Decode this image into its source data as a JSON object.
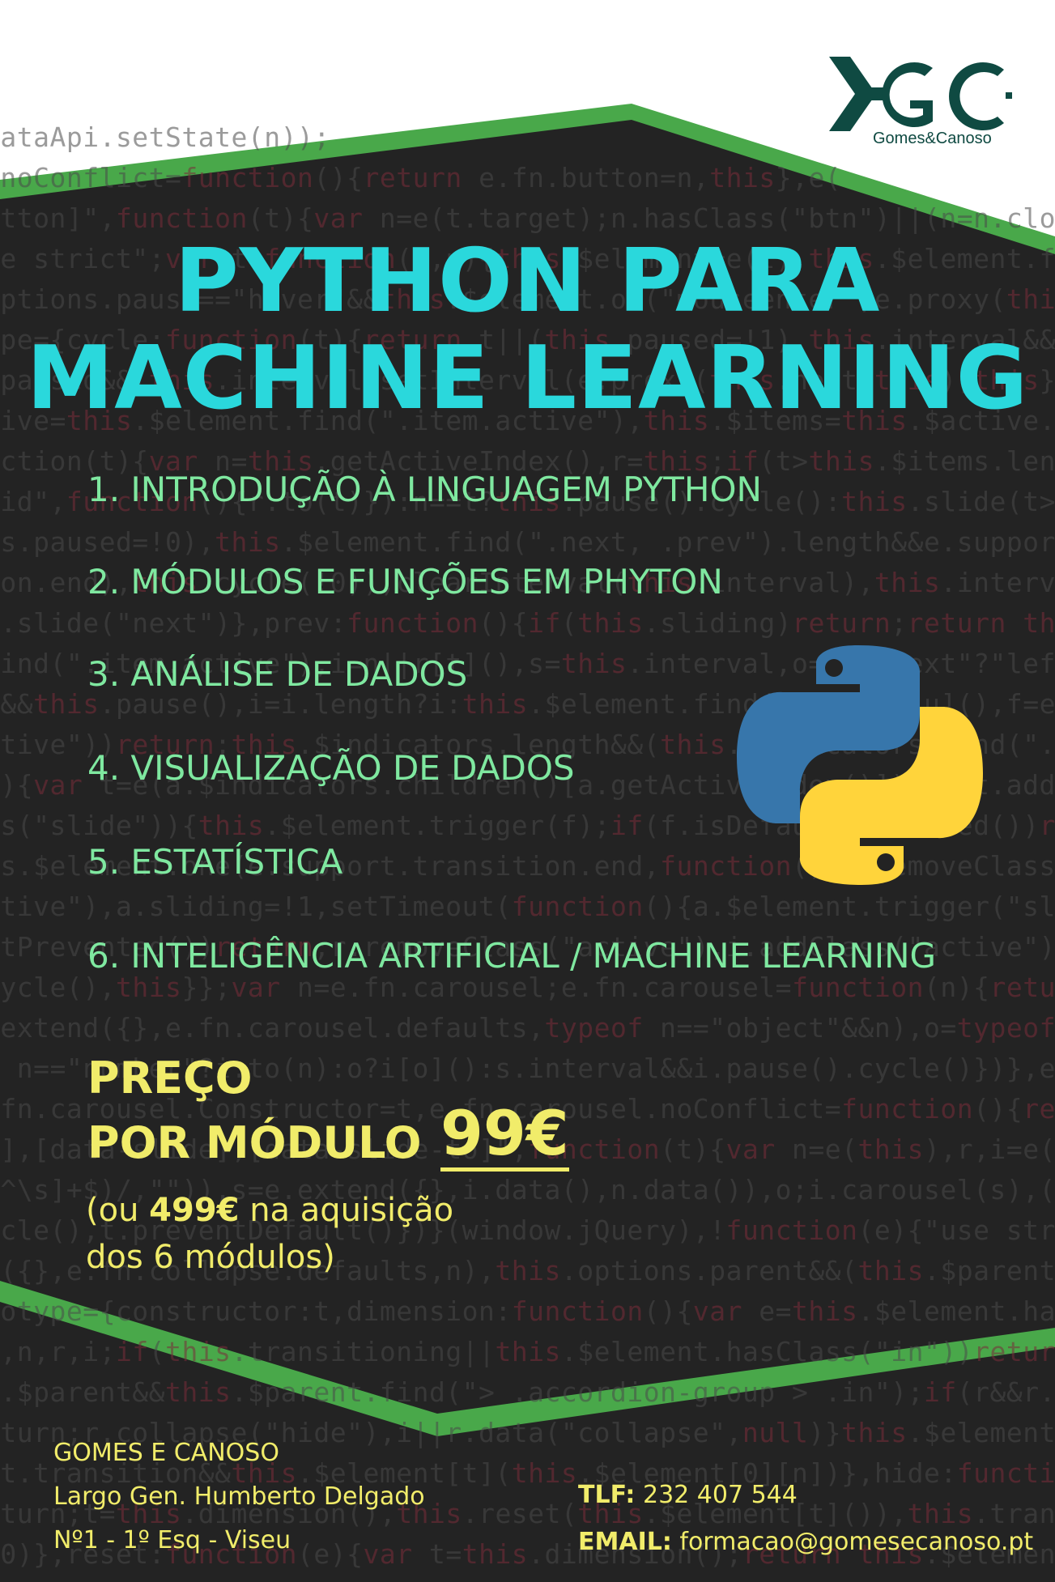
{
  "brand": {
    "logo_name": "Gomes&Canoso",
    "colors": {
      "logo": "#0f4a42",
      "green_band": "#49a84a",
      "dark_bg": "#232323",
      "title": "#2ad8dc",
      "modules": "#7fe8a0",
      "price": "#f1ec6a"
    }
  },
  "title": {
    "line1": "PYTHON PARA",
    "line2": "MACHINE LEARNING"
  },
  "modules": [
    "1. INTRODUÇÃO À LINGUAGEM PYTHON",
    "2. MÓDULOS E FUNÇÕES EM PHYTON",
    "3. ANÁLISE DE DADOS",
    "4. VISUALIZAÇÃO DE DADOS",
    "5. ESTATÍSTICA",
    "6. INTELIGÊNCIA ARTIFICIAL / MACHINE LEARNING"
  ],
  "price": {
    "label_line1": "PREÇO",
    "label_line2": "POR MÓDULO",
    "value": "99€",
    "note_prefix": "(ou ",
    "note_bold": "499€",
    "note_suffix": " na aquisição",
    "note_line2": "dos 6 módulos)"
  },
  "address": {
    "company": "GOMES E CANOSO",
    "street": "Largo Gen. Humberto Delgado",
    "number": "Nº1 - 1º Esq - Viseu"
  },
  "contacts": {
    "phone_label": "TLF:",
    "phone": "232 407 544",
    "email_label": "EMAIL:",
    "email": "formacao@gomesecanoso.pt"
  },
  "python_logo_icon": "python-logo-icon",
  "logo_icon": "gomes-canoso-logo-icon"
}
